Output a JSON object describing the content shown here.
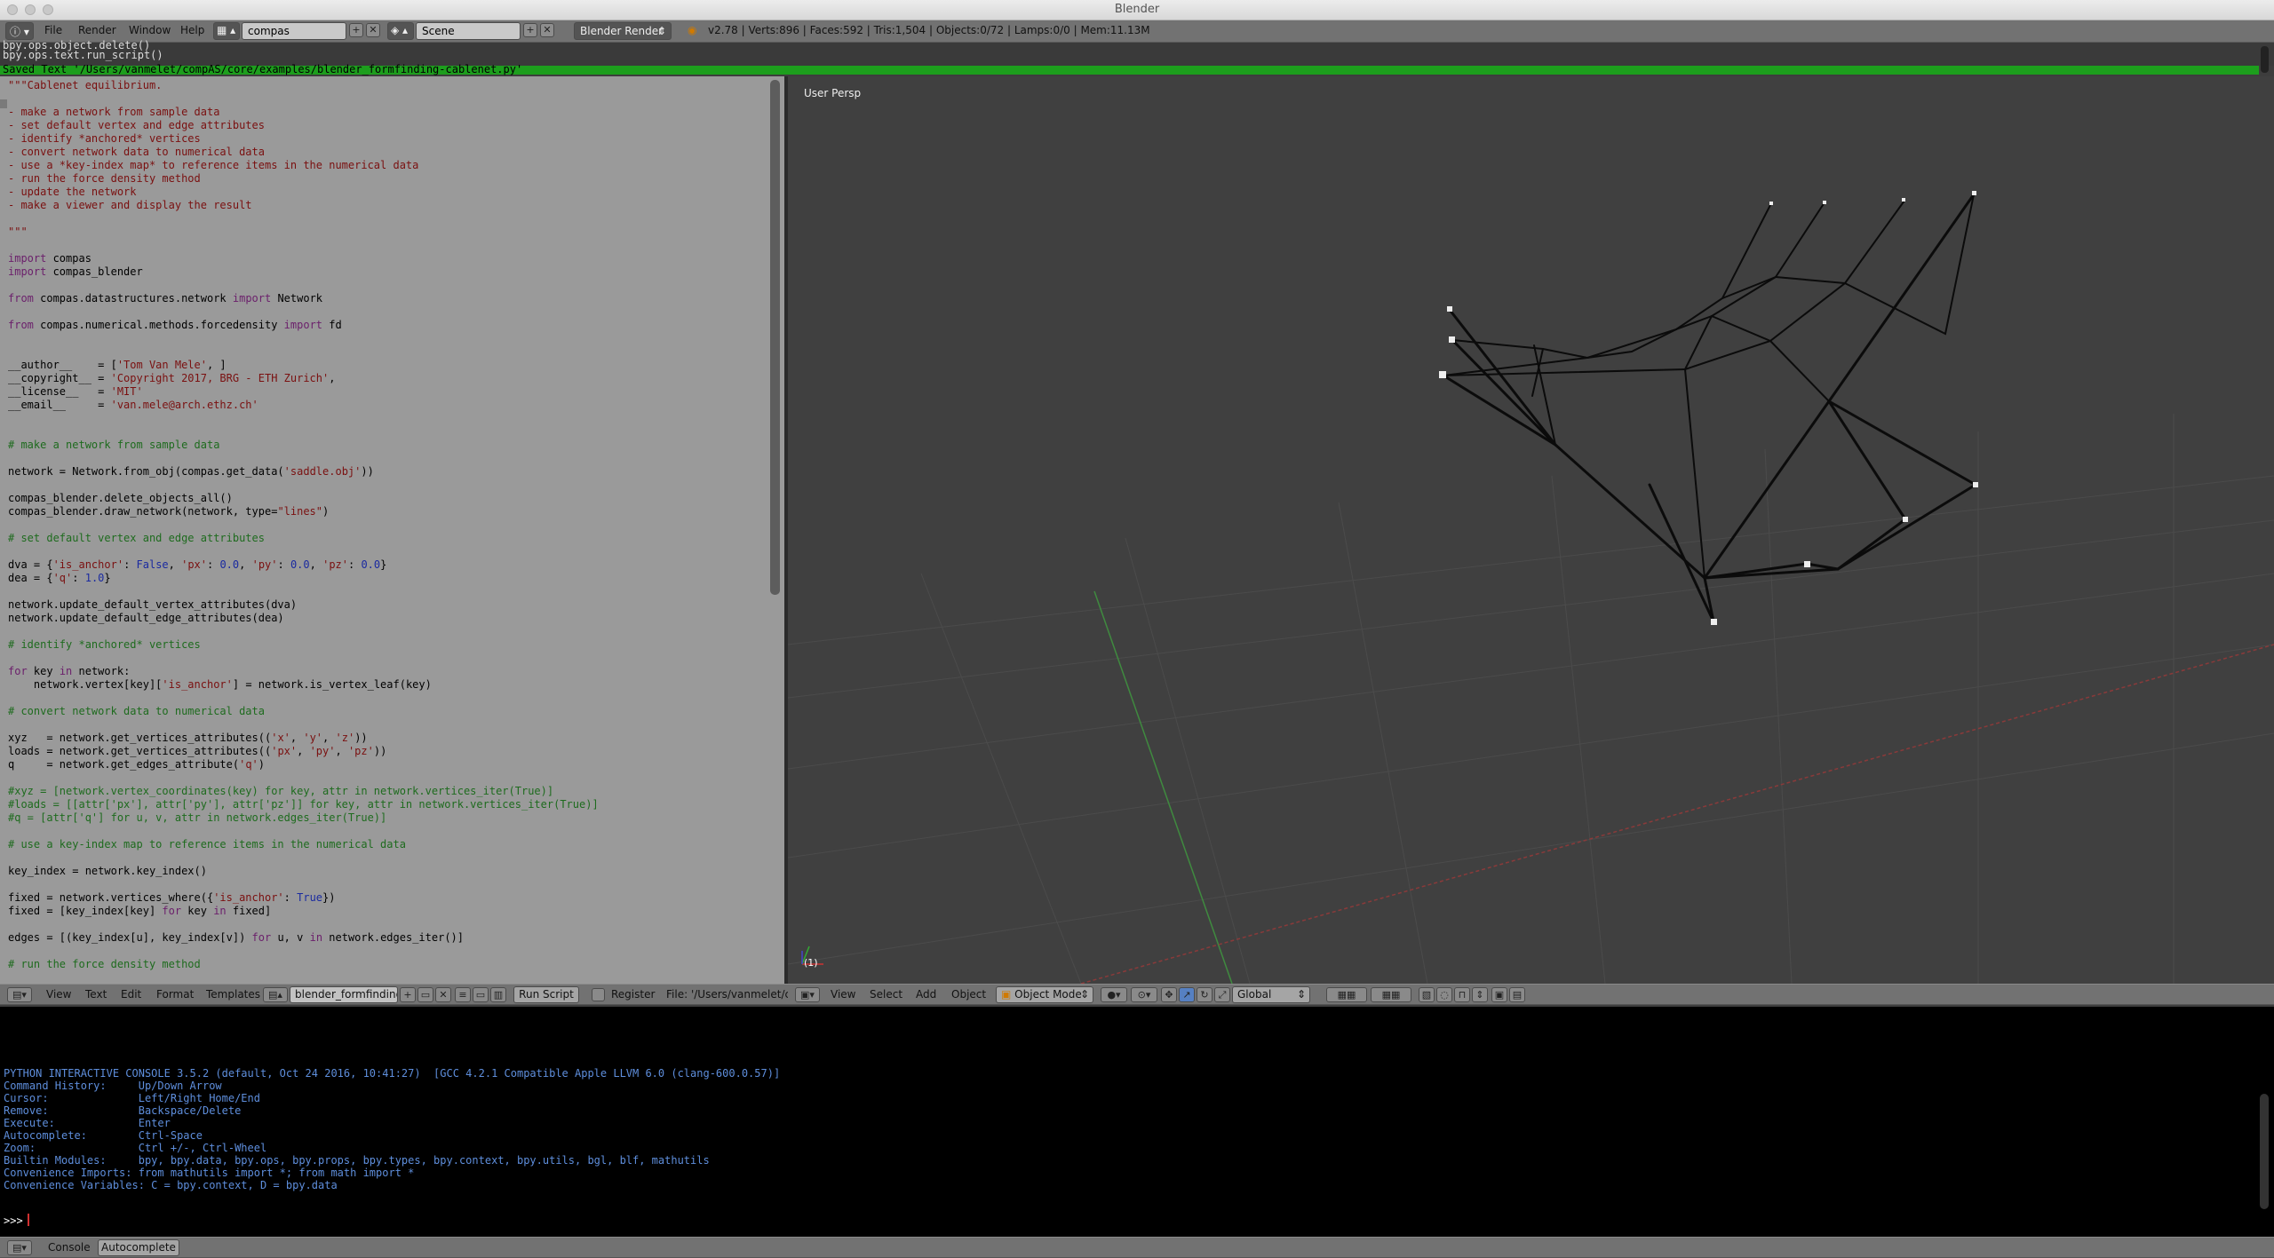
{
  "window": {
    "title": "Blender"
  },
  "info_header": {
    "menus": [
      "File",
      "Render",
      "Window",
      "Help"
    ],
    "screen_layout": "compas",
    "scene": "Scene",
    "render_engine": "Blender Render",
    "stats": "v2.78 | Verts:896 | Faces:592 | Tris:1,504 | Objects:0/72 | Lamps:0/0 | Mem:11.13M"
  },
  "info_log": {
    "lines": [
      "bpy.ops.object.delete()",
      "bpy.ops.text.run_script()"
    ],
    "saved_message": "Saved Text '/Users/vanmelet/compAS/core/examples/blender_formfinding-cablenet.py'"
  },
  "text_editor": {
    "code_lines": [
      [
        {
          "t": "\"\"\"Cablenet equilibrium.",
          "c": "str"
        }
      ],
      [
        {
          "t": "",
          "c": "str"
        }
      ],
      [
        {
          "t": "- make a network from sample data",
          "c": "str"
        }
      ],
      [
        {
          "t": "- set default vertex and edge attributes",
          "c": "str"
        }
      ],
      [
        {
          "t": "- identify *anchored* vertices",
          "c": "str"
        }
      ],
      [
        {
          "t": "- convert network data to numerical data",
          "c": "str"
        }
      ],
      [
        {
          "t": "- use a *key-index map* to reference items in the numerical data",
          "c": "str"
        }
      ],
      [
        {
          "t": "- run the force density method",
          "c": "str"
        }
      ],
      [
        {
          "t": "- update the network",
          "c": "str"
        }
      ],
      [
        {
          "t": "- make a viewer and display the result",
          "c": "str"
        }
      ],
      [
        {
          "t": "",
          "c": ""
        }
      ],
      [
        {
          "t": "\"\"\"",
          "c": "str"
        }
      ],
      [
        {
          "t": "",
          "c": ""
        }
      ],
      [
        {
          "t": "import",
          "c": "kw"
        },
        {
          "t": " compas",
          "c": ""
        }
      ],
      [
        {
          "t": "import",
          "c": "kw"
        },
        {
          "t": " compas_blender",
          "c": ""
        }
      ],
      [
        {
          "t": "",
          "c": ""
        }
      ],
      [
        {
          "t": "from",
          "c": "kw"
        },
        {
          "t": " compas.datastructures.network ",
          "c": ""
        },
        {
          "t": "import",
          "c": "kw"
        },
        {
          "t": " Network",
          "c": ""
        }
      ],
      [
        {
          "t": "",
          "c": ""
        }
      ],
      [
        {
          "t": "from",
          "c": "kw"
        },
        {
          "t": " compas.numerical.methods.forcedensity ",
          "c": ""
        },
        {
          "t": "import",
          "c": "kw"
        },
        {
          "t": " fd",
          "c": ""
        }
      ],
      [
        {
          "t": "",
          "c": ""
        }
      ],
      [
        {
          "t": "",
          "c": ""
        }
      ],
      [
        {
          "t": "__author__    = [",
          "c": ""
        },
        {
          "t": "'Tom Van Mele'",
          "c": "str"
        },
        {
          "t": ", ]",
          "c": ""
        }
      ],
      [
        {
          "t": "__copyright__ = ",
          "c": ""
        },
        {
          "t": "'Copyright 2017, BRG - ETH Zurich'",
          "c": "str"
        },
        {
          "t": ",",
          "c": ""
        }
      ],
      [
        {
          "t": "__license__   = ",
          "c": ""
        },
        {
          "t": "'MIT'",
          "c": "str"
        }
      ],
      [
        {
          "t": "__email__     = ",
          "c": ""
        },
        {
          "t": "'van.mele@arch.ethz.ch'",
          "c": "str"
        }
      ],
      [
        {
          "t": "",
          "c": ""
        }
      ],
      [
        {
          "t": "",
          "c": ""
        }
      ],
      [
        {
          "t": "# make a network from sample data",
          "c": "com"
        }
      ],
      [
        {
          "t": "",
          "c": ""
        }
      ],
      [
        {
          "t": "network = Network.from_obj(compas.get_data(",
          "c": ""
        },
        {
          "t": "'saddle.obj'",
          "c": "str"
        },
        {
          "t": "))",
          "c": ""
        }
      ],
      [
        {
          "t": "",
          "c": ""
        }
      ],
      [
        {
          "t": "compas_blender.delete_objects_all()",
          "c": ""
        }
      ],
      [
        {
          "t": "compas_blender.draw_network(network, type=",
          "c": ""
        },
        {
          "t": "\"lines\"",
          "c": "str"
        },
        {
          "t": ")",
          "c": ""
        }
      ],
      [
        {
          "t": "",
          "c": ""
        }
      ],
      [
        {
          "t": "# set default vertex and edge attributes",
          "c": "com"
        }
      ],
      [
        {
          "t": "",
          "c": ""
        }
      ],
      [
        {
          "t": "dva = {",
          "c": ""
        },
        {
          "t": "'is_anchor'",
          "c": "str"
        },
        {
          "t": ": ",
          "c": ""
        },
        {
          "t": "False",
          "c": "blu"
        },
        {
          "t": ", ",
          "c": ""
        },
        {
          "t": "'px'",
          "c": "str"
        },
        {
          "t": ": ",
          "c": ""
        },
        {
          "t": "0.0",
          "c": "blu"
        },
        {
          "t": ", ",
          "c": ""
        },
        {
          "t": "'py'",
          "c": "str"
        },
        {
          "t": ": ",
          "c": ""
        },
        {
          "t": "0.0",
          "c": "blu"
        },
        {
          "t": ", ",
          "c": ""
        },
        {
          "t": "'pz'",
          "c": "str"
        },
        {
          "t": ": ",
          "c": ""
        },
        {
          "t": "0.0",
          "c": "blu"
        },
        {
          "t": "}",
          "c": ""
        }
      ],
      [
        {
          "t": "dea = {",
          "c": ""
        },
        {
          "t": "'q'",
          "c": "str"
        },
        {
          "t": ": ",
          "c": ""
        },
        {
          "t": "1.0",
          "c": "blu"
        },
        {
          "t": "}",
          "c": ""
        }
      ],
      [
        {
          "t": "",
          "c": ""
        }
      ],
      [
        {
          "t": "network.update_default_vertex_attributes(dva)",
          "c": ""
        }
      ],
      [
        {
          "t": "network.update_default_edge_attributes(dea)",
          "c": ""
        }
      ],
      [
        {
          "t": "",
          "c": ""
        }
      ],
      [
        {
          "t": "# identify *anchored* vertices",
          "c": "com"
        }
      ],
      [
        {
          "t": "",
          "c": ""
        }
      ],
      [
        {
          "t": "for",
          "c": "kw"
        },
        {
          "t": " key ",
          "c": ""
        },
        {
          "t": "in",
          "c": "kw"
        },
        {
          "t": " network:",
          "c": ""
        }
      ],
      [
        {
          "t": "    network.vertex[key][",
          "c": ""
        },
        {
          "t": "'is_anchor'",
          "c": "str"
        },
        {
          "t": "] = network.is_vertex_leaf(key)",
          "c": ""
        }
      ],
      [
        {
          "t": "",
          "c": ""
        }
      ],
      [
        {
          "t": "# convert network data to numerical data",
          "c": "com"
        }
      ],
      [
        {
          "t": "",
          "c": ""
        }
      ],
      [
        {
          "t": "xyz   = network.get_vertices_attributes((",
          "c": ""
        },
        {
          "t": "'x'",
          "c": "str"
        },
        {
          "t": ", ",
          "c": ""
        },
        {
          "t": "'y'",
          "c": "str"
        },
        {
          "t": ", ",
          "c": ""
        },
        {
          "t": "'z'",
          "c": "str"
        },
        {
          "t": "))",
          "c": ""
        }
      ],
      [
        {
          "t": "loads = network.get_vertices_attributes((",
          "c": ""
        },
        {
          "t": "'px'",
          "c": "str"
        },
        {
          "t": ", ",
          "c": ""
        },
        {
          "t": "'py'",
          "c": "str"
        },
        {
          "t": ", ",
          "c": ""
        },
        {
          "t": "'pz'",
          "c": "str"
        },
        {
          "t": "))",
          "c": ""
        }
      ],
      [
        {
          "t": "q     = network.get_edges_attribute(",
          "c": ""
        },
        {
          "t": "'q'",
          "c": "str"
        },
        {
          "t": ")",
          "c": ""
        }
      ],
      [
        {
          "t": "",
          "c": ""
        }
      ],
      [
        {
          "t": "#xyz = [network.vertex_coordinates(key) for key, attr in network.vertices_iter(True)]",
          "c": "com"
        }
      ],
      [
        {
          "t": "#loads = [[attr['px'], attr['py'], attr['pz']] for key, attr in network.vertices_iter(True)]",
          "c": "com"
        }
      ],
      [
        {
          "t": "#q = [attr['q'] for u, v, attr in network.edges_iter(True)]",
          "c": "com"
        }
      ],
      [
        {
          "t": "",
          "c": ""
        }
      ],
      [
        {
          "t": "# use a key-index map to reference items in the numerical data",
          "c": "com"
        }
      ],
      [
        {
          "t": "",
          "c": ""
        }
      ],
      [
        {
          "t": "key_index = network.key_index()",
          "c": ""
        }
      ],
      [
        {
          "t": "",
          "c": ""
        }
      ],
      [
        {
          "t": "fixed = network.vertices_where({",
          "c": ""
        },
        {
          "t": "'is_anchor'",
          "c": "str"
        },
        {
          "t": ": ",
          "c": ""
        },
        {
          "t": "True",
          "c": "blu"
        },
        {
          "t": "})",
          "c": ""
        }
      ],
      [
        {
          "t": "fixed = [key_index[key] ",
          "c": ""
        },
        {
          "t": "for",
          "c": "kw"
        },
        {
          "t": " key ",
          "c": ""
        },
        {
          "t": "in",
          "c": "kw"
        },
        {
          "t": " fixed]",
          "c": ""
        }
      ],
      [
        {
          "t": "",
          "c": ""
        }
      ],
      [
        {
          "t": "edges = [(key_index[u], key_index[v]) ",
          "c": ""
        },
        {
          "t": "for",
          "c": "kw"
        },
        {
          "t": " u, v ",
          "c": ""
        },
        {
          "t": "in",
          "c": "kw"
        },
        {
          "t": " network.edges_iter()]",
          "c": ""
        }
      ],
      [
        {
          "t": "",
          "c": ""
        }
      ],
      [
        {
          "t": "# run the force density method",
          "c": "com"
        }
      ]
    ],
    "header": {
      "menus": [
        "View",
        "Text",
        "Edit",
        "Format",
        "Templates"
      ],
      "file_name": "blender_formfinding...",
      "run_script": "Run Script",
      "register": "Register",
      "file_path": "File: '/Users/vanmelet/com"
    }
  },
  "viewport": {
    "label": "User Persp",
    "frame": "(1)",
    "header": {
      "menus": [
        "View",
        "Select",
        "Add",
        "Object"
      ],
      "mode": "Object Mode",
      "orientation": "Global"
    }
  },
  "console": {
    "banner": "PYTHON INTERACTIVE CONSOLE 3.5.2 (default, Oct 24 2016, 10:41:27)  [GCC 4.2.1 Compatible Apple LLVM 6.0 (clang-600.0.57)]",
    "help_lines": [
      "Command History:     Up/Down Arrow",
      "Cursor:              Left/Right Home/End",
      "Remove:              Backspace/Delete",
      "Execute:             Enter",
      "Autocomplete:        Ctrl-Space",
      "Zoom:                Ctrl +/-, Ctrl-Wheel",
      "Builtin Modules:     bpy, bpy.data, bpy.ops, bpy.props, bpy.types, bpy.context, bpy.utils, bgl, blf, mathutils",
      "Convenience Imports: from mathutils import *; from math import *",
      "Convenience Variables: C = bpy.context, D = bpy.data"
    ],
    "prompt": ">>> ",
    "footer": {
      "console_btn": "Console",
      "autocomplete_btn": "Autocomplete"
    }
  },
  "colors": {
    "save_ok": "#1d9e1d",
    "console_text": "#5e8edc",
    "string": "#7a1010",
    "comment": "#1e6b1e",
    "keyword": "#6b1f6b"
  }
}
